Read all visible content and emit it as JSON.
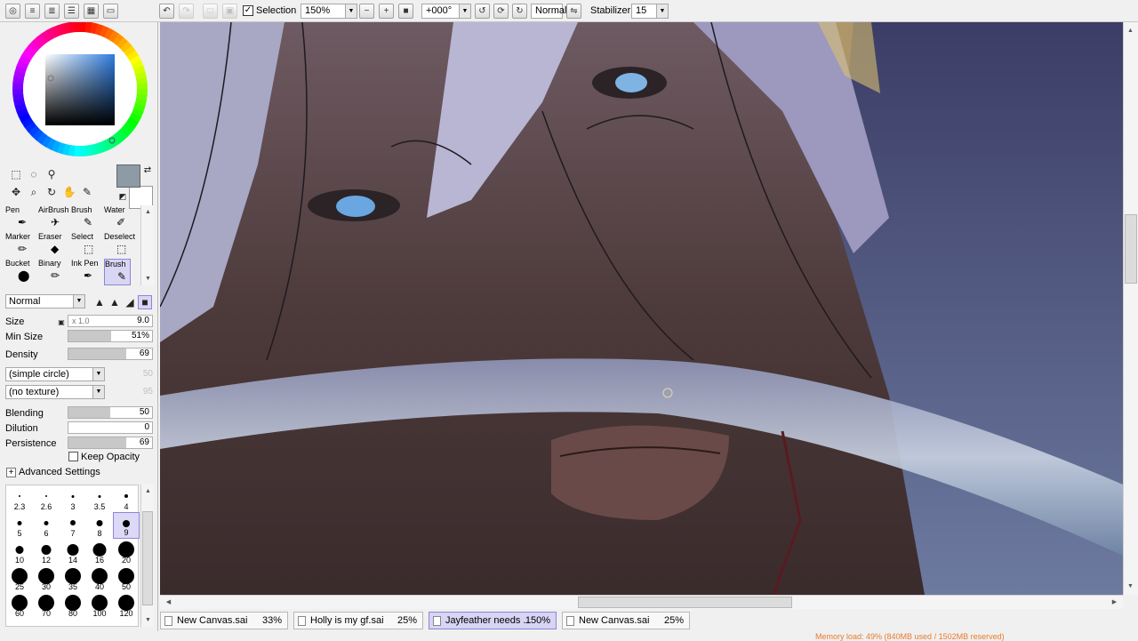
{
  "toolbar": {
    "selection_label": "Selection",
    "selection_checked": true,
    "zoom_value": "150%",
    "rotation_value": "+000°",
    "blend_mode": "Normal",
    "stabilizer_label": "Stabilizer",
    "stabilizer_value": "15"
  },
  "color": {
    "current": "#8e9aa6",
    "secondary": "#ffffff",
    "square_hue": "#2e7de0"
  },
  "tools": {
    "brushes": [
      {
        "label": "Pen"
      },
      {
        "label": "AirBrush"
      },
      {
        "label": "Brush"
      },
      {
        "label": "Water"
      },
      {
        "label": "Marker"
      },
      {
        "label": "Eraser"
      },
      {
        "label": "Select"
      },
      {
        "label": "Deselect"
      },
      {
        "label": "Bucket"
      },
      {
        "label": "Binary"
      },
      {
        "label": "Ink Pen"
      },
      {
        "label": "Brush"
      }
    ],
    "active_index": 11
  },
  "brush_settings": {
    "mode": "Normal",
    "size_label": "Size",
    "size_multiplier": "x 1.0",
    "size_value": "9.0",
    "min_size_label": "Min Size",
    "min_size_value": "51%",
    "min_size_fraction": 0.51,
    "density_label": "Density",
    "density_value": "69",
    "density_fraction": 0.69,
    "shape": "(simple circle)",
    "shape_strength": "50",
    "texture": "(no texture)",
    "texture_strength": "95",
    "blending_label": "Blending",
    "blending_value": "50",
    "blending_fraction": 0.5,
    "dilution_label": "Dilution",
    "dilution_value": "0",
    "dilution_fraction": 0,
    "persistence_label": "Persistence",
    "persistence_value": "69",
    "persistence_fraction": 0.69,
    "keep_opacity_label": "Keep Opacity",
    "advanced_label": "Advanced Settings"
  },
  "brush_sizes": [
    "2.3",
    "2.6",
    "3",
    "3.5",
    "4",
    "5",
    "6",
    "7",
    "8",
    "9",
    "10",
    "12",
    "14",
    "16",
    "20",
    "25",
    "30",
    "35",
    "40",
    "50",
    "60",
    "70",
    "80",
    "100",
    "120"
  ],
  "brush_sizes_active": "9",
  "tabs": [
    {
      "name": "New Canvas.sai",
      "zoom": "33%",
      "active": false
    },
    {
      "name": "Holly is my gf.sai",
      "zoom": "25%",
      "active": false
    },
    {
      "name": "Jayfeather needs ...",
      "zoom": "150%",
      "active": true
    },
    {
      "name": "New Canvas.sai",
      "zoom": "25%",
      "active": false
    }
  ],
  "status": {
    "memory": "Memory load: 49% (840MB used / 1502MB reserved)"
  }
}
